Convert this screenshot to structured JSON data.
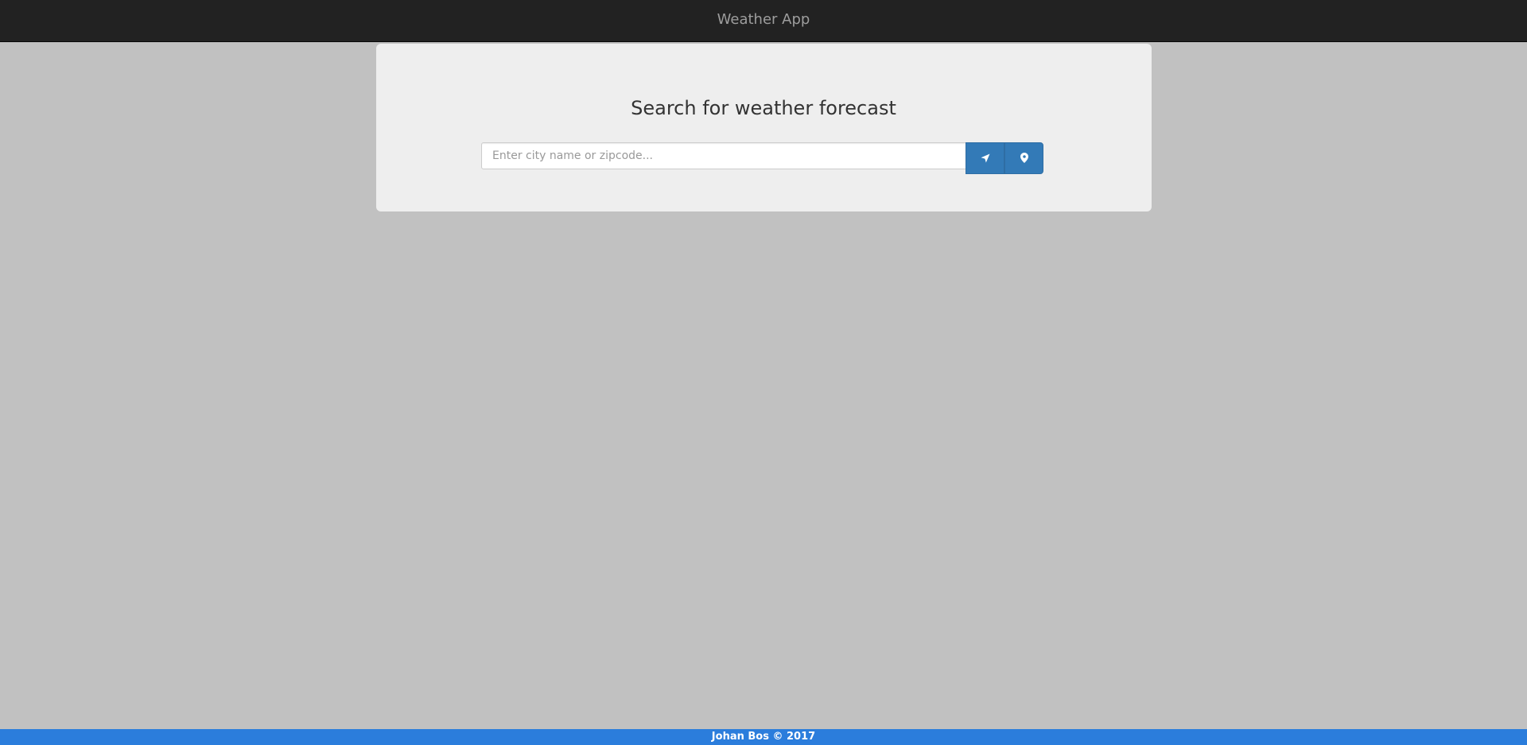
{
  "navbar": {
    "brand": "Weather App"
  },
  "search": {
    "title": "Search for weather forecast",
    "placeholder": "Enter city name or zipcode...",
    "value": "",
    "locate_icon": "location-arrow-icon",
    "pin_icon": "map-marker-icon"
  },
  "footer": {
    "text": "Johan Bos © 2017"
  },
  "colors": {
    "navbar_bg": "#222222",
    "page_bg": "#c1c1c1",
    "panel_bg": "#eeeeee",
    "button_primary": "#337ab7",
    "footer_bg": "#2b7ddc"
  }
}
